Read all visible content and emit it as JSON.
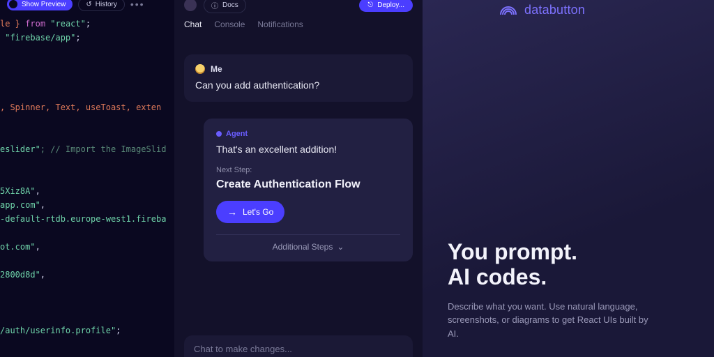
{
  "code": {
    "toolbar": {
      "show_preview": "Show Preview",
      "history": "History"
    },
    "line1_kw": "le }",
    "line1_from": "from",
    "line1_mod": "\"react\"",
    "line2_mod": "\"firebase/app\"",
    "line7_ids": ", Spinner, Text, useToast, exten",
    "line9_str": "eslider\"",
    "line9_cmt": "; // Import the ImageSlid",
    "line11_str": "5Xiz8A\"",
    "line12_str": "app.com\"",
    "line13_str": "-default-rtdb.europe-west1.fireba",
    "line14_str": "ot.com\"",
    "line15_str": "2800d8d\"",
    "line18_str": "/auth/userinfo.profile\""
  },
  "chat": {
    "top": {
      "docs": "Docs",
      "deploy": "Deploy..."
    },
    "tabs": {
      "chat": "Chat",
      "console": "Console",
      "notifications": "Notifications"
    },
    "user": {
      "name": "Me",
      "text": "Can you add authentication?"
    },
    "agent": {
      "label": "Agent",
      "text": "That's an excellent addition!",
      "next_step_label": "Next Step:",
      "next_step_title": "Create Authentication Flow",
      "letsgo": "Let's Go",
      "additional": "Additional Steps"
    },
    "input_placeholder": "Chat to make changes..."
  },
  "marketing": {
    "brand": "databutton",
    "hero_line1": "You prompt.",
    "hero_line2": "AI codes.",
    "hero_sub": "Describe what you want. Use natural language, screenshots, or diagrams to get React UIs built by AI."
  }
}
